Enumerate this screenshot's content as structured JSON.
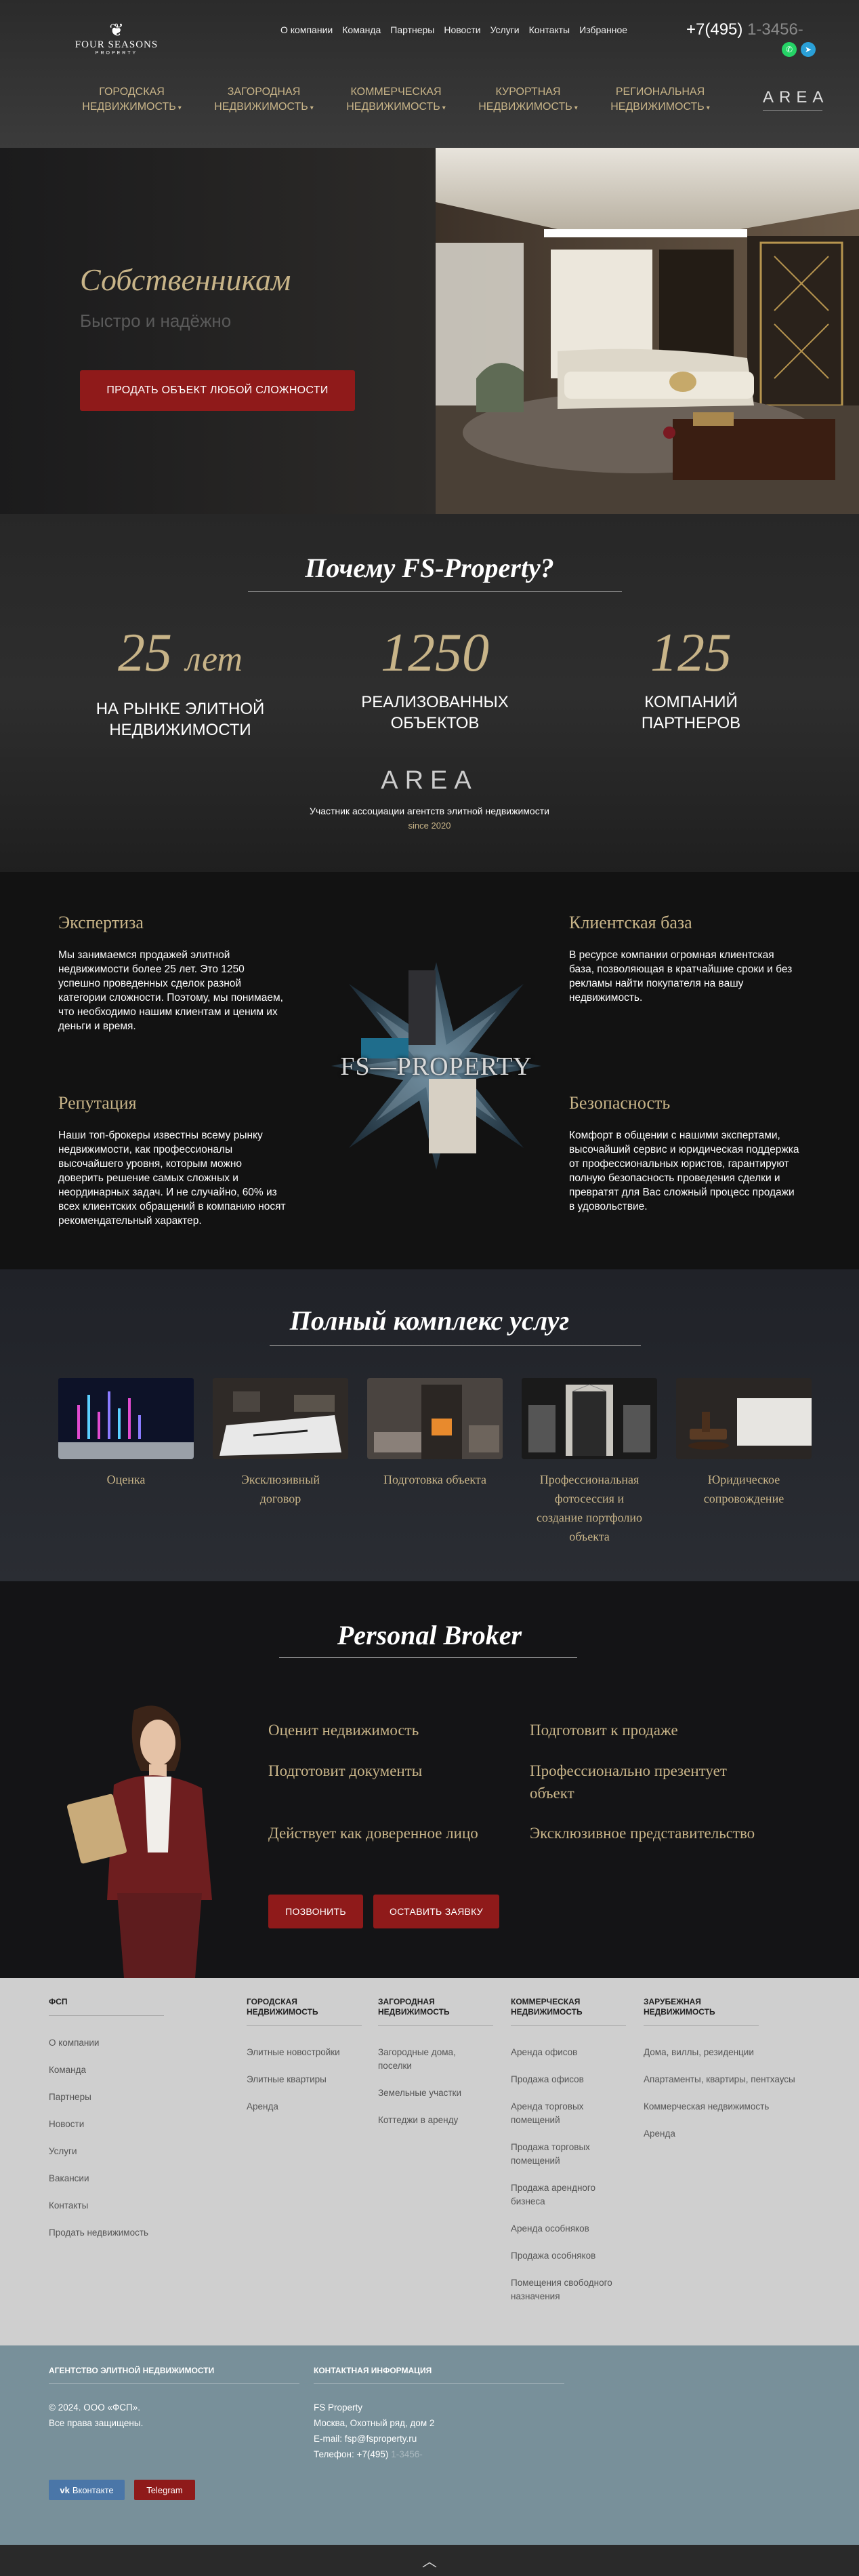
{
  "header": {
    "logo": {
      "name": "FOUR SEASONS",
      "sub": "PROPERTY"
    },
    "top_nav": [
      "О компании",
      "Команда",
      "Партнеры",
      "Новости",
      "Услуги",
      "Контакты",
      "Избранное"
    ],
    "phone_main": "+7(495)",
    "phone_rest": "1-3456-",
    "main_nav": [
      {
        "l1": "ГОРОДСКАЯ",
        "l2": "НЕДВИЖИМОСТЬ"
      },
      {
        "l1": "ЗАГОРОДНАЯ",
        "l2": "НЕДВИЖИМОСТЬ"
      },
      {
        "l1": "КОММЕРЧЕСКАЯ",
        "l2": "НЕДВИЖИМОСТЬ"
      },
      {
        "l1": "КУРОРТНАЯ",
        "l2": "НЕДВИЖИМОСТЬ"
      },
      {
        "l1": "РЕГИОНАЛЬНАЯ",
        "l2": "НЕДВИЖИМОСТЬ"
      }
    ],
    "area_logo": "AREA"
  },
  "hero": {
    "title": "Собственникам",
    "subtitle": "Быстро и надёжно",
    "cta": "ПРОДАТЬ ОБЪЕКТ ЛЮБОЙ СЛОЖНОСТИ"
  },
  "why": {
    "title": "Почему FS-Property?",
    "stats": [
      {
        "num": "25",
        "unit": "лет",
        "l1": "НА РЫНКЕ ЭЛИТНОЙ",
        "l2": "НЕДВИЖИМОСТИ"
      },
      {
        "num": "1250",
        "unit": "",
        "l1": "РЕАЛИЗОВАННЫХ",
        "l2": "ОБЪЕКТОВ"
      },
      {
        "num": "125",
        "unit": "",
        "l1": "КОМПАНИЙ",
        "l2": "ПАРТНЕРОВ"
      }
    ],
    "area": "AREA",
    "member": "Участник ассоциации агентств элитной недвижимости",
    "since": "since 2020"
  },
  "features": [
    {
      "title": "Экспертиза",
      "text": "Мы занимаемся продажей элитной недвижимости более 25 лет. Это 1250 успешно проведенных сделок разной категории сложности. Поэтому, мы понимаем, что необходимо нашим клиентам и ценим их деньги и время."
    },
    {
      "title": "Клиентская база",
      "text": "В ресурсе компании огромная клиентская база, позволяющая в кратчайшие сроки и без рекламы найти покупателя на вашу недвижимость."
    },
    {
      "title": "Репутация",
      "text": "Наши топ-брокеры известны всему рынку недвижимости, как профессионалы высочайшего уровня, которым можно доверить решение самых сложных и неординарных задач. И не случайно, 60% из всех клиентских обращений в компанию носят рекомендательный характер."
    },
    {
      "title": "Безопасность",
      "text": "Комфорт в общении с нашими экспертами, высочайший сервис и юридическая поддержка от профессиональных юристов, гарантируют полную безопасность проведения сделки и превратят для Вас сложный процесс продажи в удовольствие."
    }
  ],
  "features_center": "FS—PROPERTY",
  "services": {
    "title": "Полный комплекс услуг",
    "items": [
      {
        "l1": "Оценка",
        "l2": "",
        "l3": "",
        "l4": ""
      },
      {
        "l1": "Эксклюзивный",
        "l2": "договор",
        "l3": "",
        "l4": ""
      },
      {
        "l1": "Подготовка объекта",
        "l2": "",
        "l3": "",
        "l4": ""
      },
      {
        "l1": "Профессиональная",
        "l2": "фотосессия и",
        "l3": "создание портфолио",
        "l4": "объекта"
      },
      {
        "l1": "Юридическое",
        "l2": "сопровождение",
        "l3": "",
        "l4": ""
      }
    ]
  },
  "broker": {
    "title": "Personal Broker",
    "items": [
      "Оценит недвижимость",
      "Подготовит к продаже",
      "Подготовит документы",
      "Профессионально презентует объект",
      "Действует как доверенное лицо",
      "Эксклюзивное представительство"
    ],
    "btn_call": "ПОЗВОНИТЬ",
    "btn_request": "ОСТАВИТЬ ЗАЯВКУ"
  },
  "footer": {
    "cols": [
      {
        "h1": "ФСП",
        "h2": "",
        "links": [
          "О компании",
          "Команда",
          "Партнеры",
          "Новости",
          "Услуги",
          "Вакансии",
          "Контакты",
          "Продать недвижимость"
        ]
      },
      {
        "h1": "ГОРОДСКАЯ",
        "h2": "НЕДВИЖИМОСТЬ",
        "links": [
          "Элитные новостройки",
          "Элитные квартиры",
          "Аренда"
        ]
      },
      {
        "h1": "ЗАГОРОДНАЯ",
        "h2": "НЕДВИЖИМОСТЬ",
        "links": [
          "Загородные дома, поселки",
          "Земельные участки",
          "Коттеджи в аренду"
        ]
      },
      {
        "h1": "КОММЕРЧЕСКАЯ",
        "h2": "НЕДВИЖИМОСТЬ",
        "links": [
          "Аренда офисов",
          "Продажа офисов",
          "Аренда торговых помещений",
          "Продажа торговых помещений",
          "Продажа арендного бизнеса",
          "Аренда особняков",
          "Продажа особняков",
          "Помещения свободного назначения"
        ]
      },
      {
        "h1": "ЗАРУБЕЖНАЯ",
        "h2": "НЕДВИЖИМОСТЬ",
        "links": [
          "Дома, виллы, резиденции",
          "Апартаменты, квартиры, пентхаусы",
          "Коммерческая недвижимость",
          "Аренда"
        ]
      }
    ]
  },
  "bottom": {
    "agency_h": "АГЕНТСТВО ЭЛИТНОЙ НЕДВИЖИМОСТИ",
    "copy1": "© 2024. ООО «ФСП».",
    "copy2": "Все права защищены.",
    "contact_h": "КОНТАКТНАЯ ИНФОРМАЦИЯ",
    "c_name": "FS Property",
    "c_addr": "Москва, Охотный ряд, дом 2",
    "c_mail": "E-mail: fsp@fsproperty.ru",
    "c_phone": "Телефон: +7(495)",
    "c_phone_rest": "1-3456-",
    "vk": "Вконтакте",
    "tg": "Telegram"
  }
}
